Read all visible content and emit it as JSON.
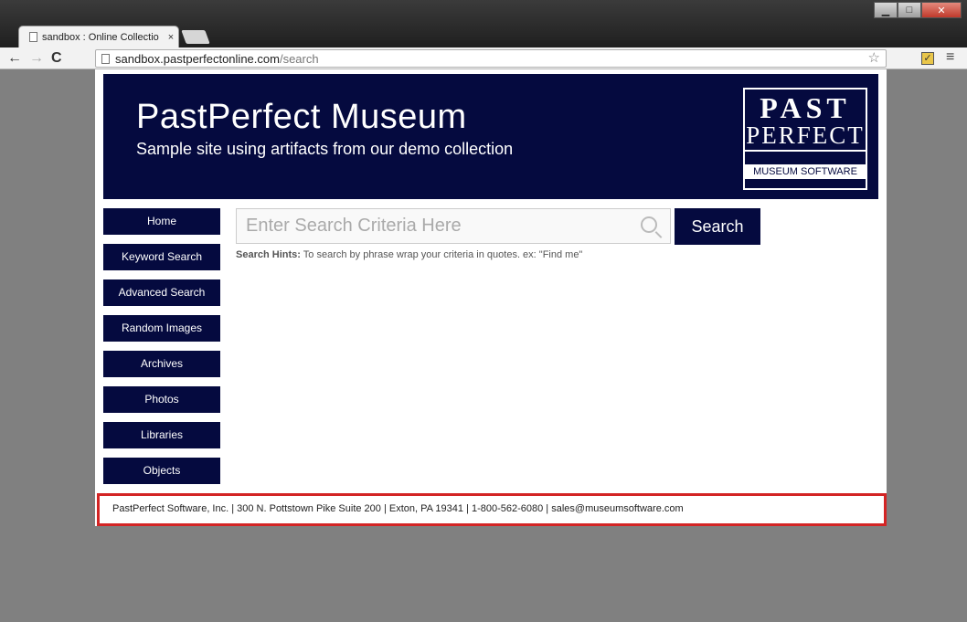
{
  "browser": {
    "tab_title": "sandbox : Online Collectio",
    "tab_close": "×",
    "url_host": "sandbox.pastperfectonline.com",
    "url_path": "/search",
    "window_buttons": [
      "▁",
      "□",
      "✕"
    ]
  },
  "header": {
    "title": "PastPerfect Museum",
    "subtitle": "Sample site using artifacts from our demo collection",
    "logo": {
      "line1": "PAST",
      "line2": "PERFECT",
      "line3": "MUSEUM SOFTWARE"
    }
  },
  "nav": {
    "items": [
      {
        "label": "Home"
      },
      {
        "label": "Keyword Search"
      },
      {
        "label": "Advanced Search"
      },
      {
        "label": "Random Images"
      },
      {
        "label": "Archives"
      },
      {
        "label": "Photos"
      },
      {
        "label": "Libraries"
      },
      {
        "label": "Objects"
      }
    ]
  },
  "search": {
    "placeholder": "Enter Search Criteria Here",
    "button_label": "Search",
    "hint_label": "Search Hints:",
    "hint_text": " To search by phrase wrap your criteria in quotes. ex: \"Find me\""
  },
  "footer": {
    "text": "PastPerfect Software, Inc. | 300 N. Pottstown Pike Suite 200 | Exton, PA 19341 | 1-800-562-6080 | sales@museumsoftware.com"
  },
  "colors": {
    "brand": "#050a3f",
    "footer_highlight": "#d32424",
    "background": "#808080"
  }
}
